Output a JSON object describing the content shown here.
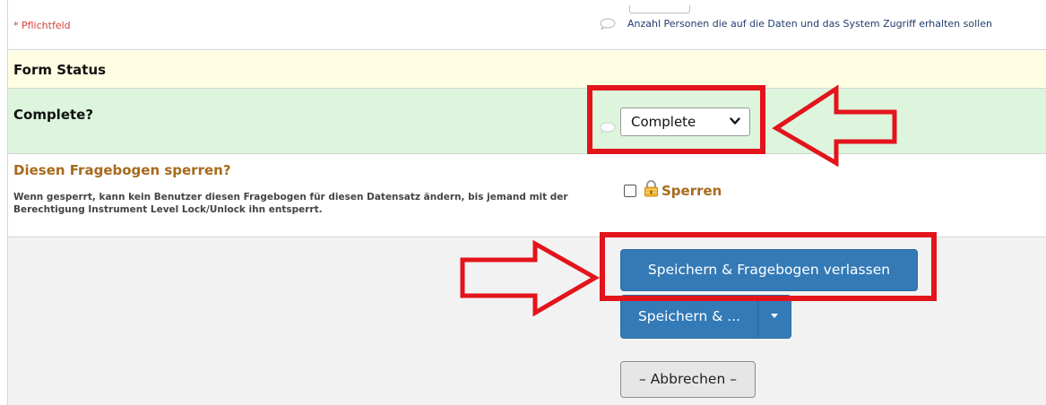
{
  "required_note": "* Pflichtfeld",
  "field_note": "Anzahl Personen die auf die Daten und das System Zugriff erhalten sollen",
  "form_status": {
    "title": "Form Status"
  },
  "complete": {
    "label": "Complete?",
    "selected": "Complete"
  },
  "lock": {
    "title": "Diesen Fragebogen sperren?",
    "description": "Wenn gesperrt, kann kein Benutzer diesen Fragebogen für diesen Datensatz ändern, bis jemand mit der Berechtigung Instrument Level Lock/Unlock ihn entsperrt.",
    "checkbox_label": "Sperren",
    "checked": false
  },
  "buttons": {
    "save_exit": "Speichern & Fragebogen verlassen",
    "save_more": "Speichern & ...",
    "cancel": "– Abbrechen –"
  },
  "colors": {
    "primary": "#337ab7",
    "header_bg": "#fffee3",
    "complete_bg": "#dcf5dc",
    "lock_accent": "#a86a1c",
    "annotation_red": "#e3141b"
  },
  "icons": {
    "note": "speech-bubble-icon",
    "lock": "padlock-icon",
    "chevron": "chevron-down-icon",
    "caret": "caret-down-icon"
  }
}
